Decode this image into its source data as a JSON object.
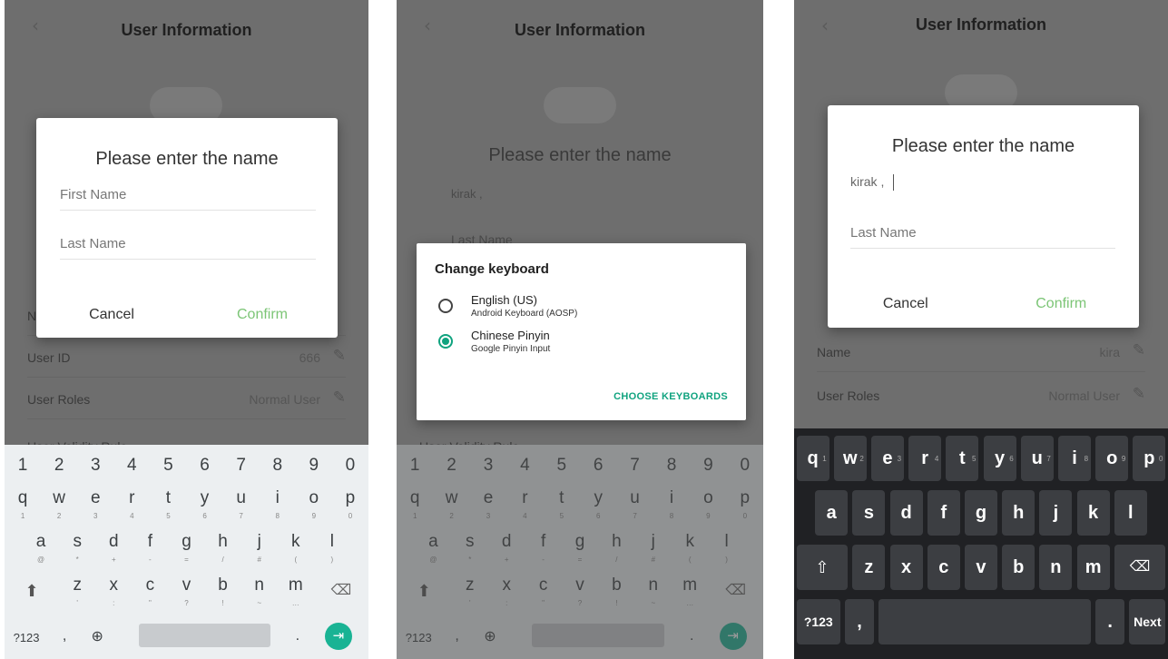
{
  "header": {
    "title": "User Information",
    "back_icon": "chevron-left-icon"
  },
  "background": {
    "user_id": {
      "label": "User ID",
      "value": "666"
    },
    "user_roles": {
      "label": "User Roles",
      "value": "Normal User"
    },
    "name": {
      "label": "Name",
      "value": "kira"
    },
    "validity_rule": {
      "label": "User Validity Rule"
    },
    "name_initial": "N",
    "edit_icon": "pencil-icon"
  },
  "name_dialog": {
    "title": "Please enter the name",
    "first_name_placeholder": "First Name",
    "last_name_placeholder": "Last Name",
    "cancel_label": "Cancel",
    "confirm_label": "Confirm",
    "first_name_value_panel2": "kirak ,",
    "first_name_value_panel3": "kirak ,"
  },
  "change_keyboard": {
    "title": "Change keyboard",
    "options": [
      {
        "name": "English (US)",
        "sub": "Android Keyboard (AOSP)",
        "selected": false
      },
      {
        "name": "Chinese Pinyin",
        "sub": "Google Pinyin Input",
        "selected": true
      }
    ],
    "action_label": "CHOOSE KEYBOARDS"
  },
  "keyboard_aosp": {
    "number_row": [
      "1",
      "2",
      "3",
      "4",
      "5",
      "6",
      "7",
      "8",
      "9",
      "0"
    ],
    "row1": [
      {
        "k": "q",
        "h": "1"
      },
      {
        "k": "w",
        "h": "2"
      },
      {
        "k": "e",
        "h": "3"
      },
      {
        "k": "r",
        "h": "4"
      },
      {
        "k": "t",
        "h": "5"
      },
      {
        "k": "y",
        "h": "6"
      },
      {
        "k": "u",
        "h": "7"
      },
      {
        "k": "i",
        "h": "8"
      },
      {
        "k": "o",
        "h": "9"
      },
      {
        "k": "p",
        "h": "0"
      }
    ],
    "row2": [
      {
        "k": "a",
        "h": "@"
      },
      {
        "k": "s",
        "h": "*"
      },
      {
        "k": "d",
        "h": "+"
      },
      {
        "k": "f",
        "h": "-"
      },
      {
        "k": "g",
        "h": "="
      },
      {
        "k": "h",
        "h": "/"
      },
      {
        "k": "j",
        "h": "#"
      },
      {
        "k": "k",
        "h": "("
      },
      {
        "k": "l",
        "h": ")"
      }
    ],
    "row3": [
      {
        "k": "z",
        "h": "'"
      },
      {
        "k": "x",
        "h": ":"
      },
      {
        "k": "c",
        "h": "\""
      },
      {
        "k": "v",
        "h": "?"
      },
      {
        "k": "b",
        "h": "!"
      },
      {
        "k": "n",
        "h": "~"
      },
      {
        "k": "m",
        "h": "…"
      }
    ],
    "symbols_label": "?123",
    "comma_label": ",",
    "period_label": ".",
    "globe_icon": "globe-icon",
    "shift_icon": "shift-icon",
    "backspace_icon": "backspace-icon",
    "enter_icon": "next-arrow-icon",
    "accent_color": "#19b394"
  },
  "keyboard_pinyin": {
    "row1": [
      {
        "k": "q",
        "h": "1"
      },
      {
        "k": "w",
        "h": "2"
      },
      {
        "k": "e",
        "h": "3"
      },
      {
        "k": "r",
        "h": "4"
      },
      {
        "k": "t",
        "h": "5"
      },
      {
        "k": "y",
        "h": "6"
      },
      {
        "k": "u",
        "h": "7"
      },
      {
        "k": "i",
        "h": "8"
      },
      {
        "k": "o",
        "h": "9"
      },
      {
        "k": "p",
        "h": "0"
      }
    ],
    "row2": [
      "a",
      "s",
      "d",
      "f",
      "g",
      "h",
      "j",
      "k",
      "l"
    ],
    "row3": [
      "z",
      "x",
      "c",
      "v",
      "b",
      "n",
      "m"
    ],
    "symbols_label": "?123",
    "comma_label": ",",
    "period_label": ".",
    "next_label": "Next",
    "shift_icon": "shift-outline-icon",
    "backspace_icon": "backspace-icon"
  }
}
